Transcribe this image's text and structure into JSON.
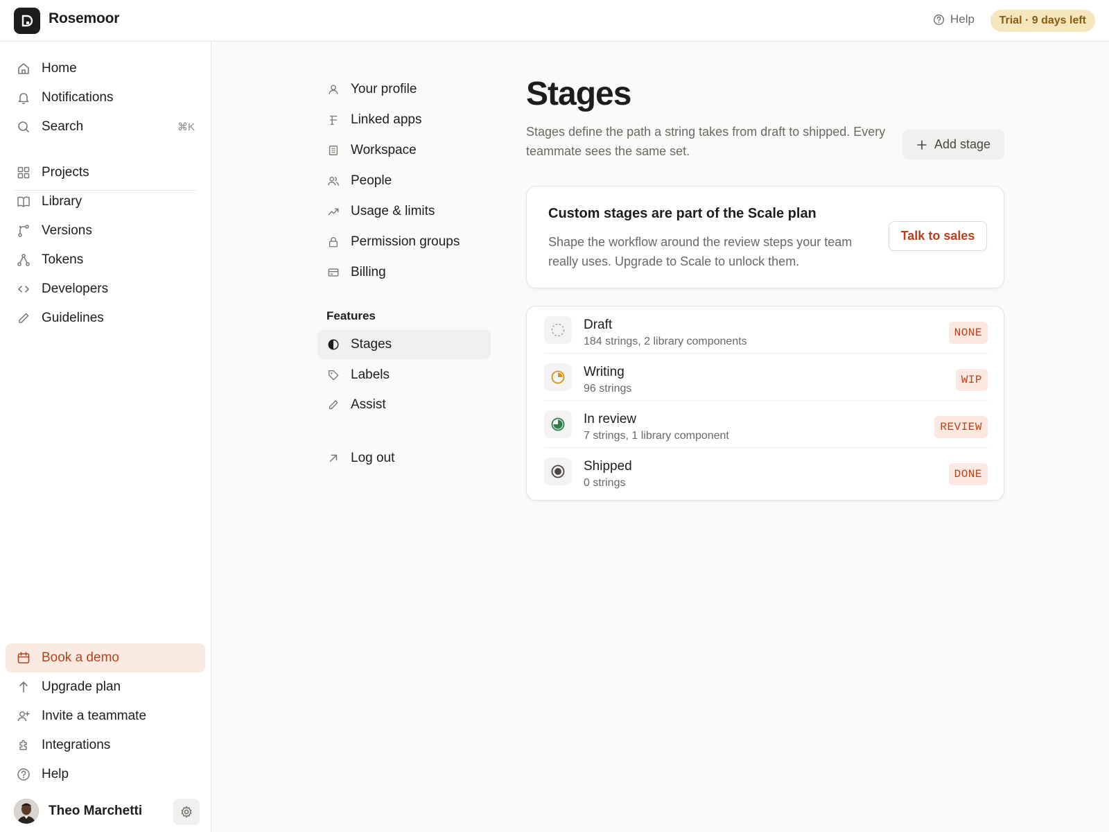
{
  "header": {
    "app_name": "Rosemoor",
    "help_label": "Help",
    "trial_badge": "Trial · 9 days left"
  },
  "sidebar": {
    "primary": [
      {
        "label": "Home",
        "icon": "home-icon"
      },
      {
        "label": "Notifications",
        "icon": "bell-icon"
      },
      {
        "label": "Search",
        "icon": "search-icon",
        "shortcut": "⌘K"
      }
    ],
    "secondary": [
      {
        "label": "Projects",
        "icon": "grid-icon"
      },
      {
        "label": "Library",
        "icon": "book-icon"
      },
      {
        "label": "Versions",
        "icon": "branch-icon"
      },
      {
        "label": "Tokens",
        "icon": "nodes-icon"
      },
      {
        "label": "Developers",
        "icon": "code-icon"
      },
      {
        "label": "Guidelines",
        "icon": "pencil-icon"
      }
    ],
    "footer": [
      {
        "label": "Book a demo",
        "icon": "calendar-icon"
      },
      {
        "label": "Upgrade plan",
        "icon": "arrow-up-icon"
      },
      {
        "label": "Invite a teammate",
        "icon": "user-plus-icon"
      },
      {
        "label": "Integrations",
        "icon": "puzzle-icon"
      },
      {
        "label": "Help",
        "icon": "help-circle-icon"
      }
    ],
    "user": {
      "name": "Theo Marchetti"
    }
  },
  "settings_menu": {
    "items": [
      {
        "label": "Your profile",
        "icon": "user-icon"
      },
      {
        "label": "Linked apps",
        "icon": "link-icon"
      },
      {
        "label": "Workspace",
        "icon": "building-icon"
      },
      {
        "label": "People",
        "icon": "people-icon"
      },
      {
        "label": "Usage & limits",
        "icon": "trend-icon"
      },
      {
        "label": "Permission groups",
        "icon": "lock-icon"
      },
      {
        "label": "Billing",
        "icon": "card-icon"
      }
    ],
    "features_heading": "Features",
    "features": [
      {
        "label": "Stages",
        "icon": "half-circle-icon",
        "active": true
      },
      {
        "label": "Labels",
        "icon": "tag-icon"
      },
      {
        "label": "Assist",
        "icon": "pencil-icon"
      }
    ],
    "logout_label": "Log out"
  },
  "main": {
    "title": "Stages",
    "description": "Stages define the path a string takes from draft to shipped. Every teammate sees the same set.",
    "add_stage_label": "Add stage",
    "upsell": {
      "title": "Custom stages are part of the Scale plan",
      "body": "Shape the workflow around the review steps your team really uses. Upgrade to Scale to unlock them.",
      "cta_label": "Talk to sales"
    },
    "stages": [
      {
        "name": "Draft",
        "detail": "184 strings, 2 library components",
        "tag": "NONE",
        "icon": "dashed-circle-icon"
      },
      {
        "name": "Writing",
        "detail": "96 strings",
        "tag": "WIP",
        "icon": "pie-quarter-icon"
      },
      {
        "name": "In review",
        "detail": "7 strings, 1 library component",
        "tag": "REVIEW",
        "icon": "pie-three-quarter-icon"
      },
      {
        "name": "Shipped",
        "detail": "0 strings",
        "tag": "DONE",
        "icon": "target-circle-icon"
      }
    ]
  },
  "colors": {
    "accent": "#b2431d",
    "trial_bg": "#f6e6bd",
    "writing": "#d4960f",
    "review": "#2f7d4f",
    "shipped": "#4a4743"
  }
}
